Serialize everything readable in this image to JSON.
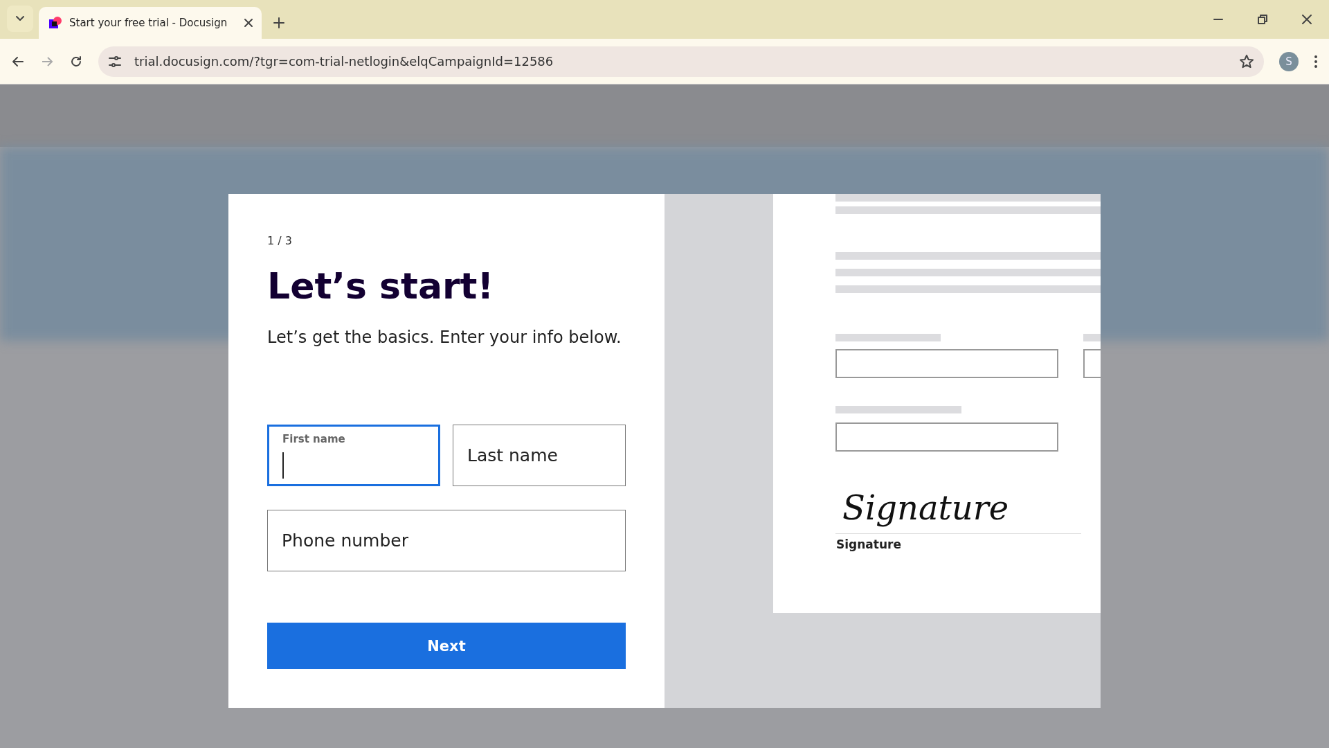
{
  "browser": {
    "tab_title": "Start your free trial - Docusign",
    "url": "trial.docusign.com/?tgr=com-trial-netlogin&elqCampaignId=12586",
    "profile_initial": "S"
  },
  "modal": {
    "step": "1 / 3",
    "heading": "Let’s start!",
    "subtitle": "Let’s get the basics. Enter your info below.",
    "fields": [
      {
        "label": "First name",
        "focused": true,
        "wide": false
      },
      {
        "placeholder": "Last name",
        "focused": false,
        "wide": false
      },
      {
        "placeholder": "Phone number",
        "focused": false,
        "wide": true
      }
    ],
    "button": "Next",
    "preview": {
      "signature_script": "Signature",
      "signature_caption": "Signature"
    }
  }
}
